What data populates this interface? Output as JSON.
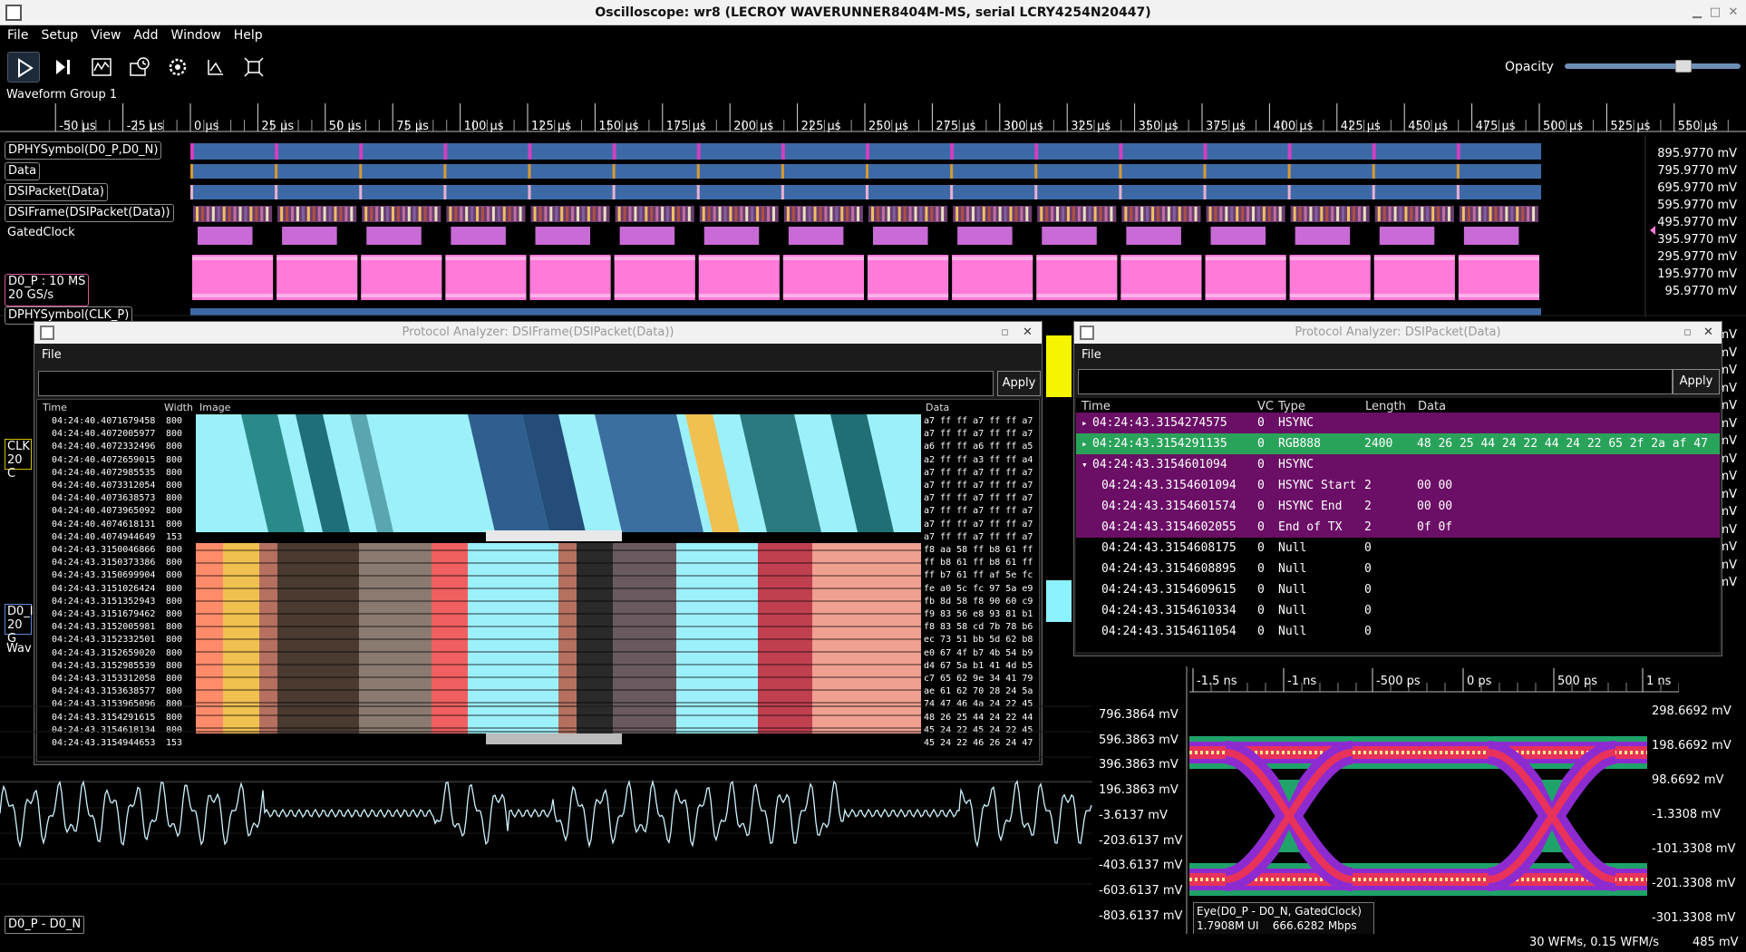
{
  "window": {
    "title": "Oscilloscope: wr8 (LECROY WAVERUNNER8404M-MS, serial LCRY4254N20447)"
  },
  "menu": [
    "File",
    "Setup",
    "View",
    "Add",
    "Window",
    "Help"
  ],
  "toolbar": {
    "opacity_label": "Opacity",
    "opacity_value": 0.7
  },
  "group_label": "Waveform Group 1",
  "time_axis": [
    "-50 µs",
    "-25 µs",
    "0 µs",
    "25 µs",
    "50 µs",
    "75 µs",
    "100 µs",
    "125 µs",
    "150 µs",
    "175 µs",
    "200 µs",
    "225 µs",
    "250 µs",
    "275 µs",
    "300 µs",
    "325 µs",
    "350 µs",
    "375 µs",
    "400 µs",
    "425 µs",
    "450 µs",
    "475 µs",
    "500 µs",
    "525 µs",
    "550 µs"
  ],
  "channels": [
    "DPHYSymbol(D0_P,D0_N)",
    "Data",
    "DSIPacket(Data)",
    "DSIFrame(DSIPacket(Data))",
    "GatedClock"
  ],
  "d0p_label": [
    "D0_P : 10 MS",
    "20 GS/s"
  ],
  "clk_label": "DPHYSymbol(CLK_P)",
  "partial_labels": {
    "clk": "CLK",
    "clk2": "20 C",
    "d0": "D0_I",
    "d0b": "20 G",
    "wav": "Wav"
  },
  "voltage_axis": [
    "895.9770 mV",
    "795.9770 mV",
    "695.9770 mV",
    "595.9770 mV",
    "495.9770 mV",
    "395.9770 mV",
    "295.9770 mV",
    "195.9770 mV",
    "95.9770 mV"
  ],
  "voltage_fragments": [
    "mV",
    "mV",
    "mV",
    "mV",
    "mV",
    "mV",
    "mV",
    "mV",
    "mV",
    "mV",
    "mV",
    "mV",
    "mV",
    "mV",
    "mV"
  ],
  "frame_window": {
    "title": "Protocol Analyzer: DSIFrame(DSIPacket(Data))",
    "menu": "File",
    "apply": "Apply",
    "headers": {
      "time": "Time",
      "width": "Width",
      "image": "Image",
      "data": "Data"
    },
    "rows": [
      {
        "time": "04:24:40.4071679458",
        "width": "800",
        "data": "a7 ff ff a7 ff ff a7"
      },
      {
        "time": "04:24:40.4072005977",
        "width": "800",
        "data": "a7 ff ff a7 ff ff a7"
      },
      {
        "time": "04:24:40.4072332496",
        "width": "800",
        "data": "a6 ff ff a6 ff ff a5"
      },
      {
        "time": "04:24:40.4072659015",
        "width": "800",
        "data": "a2 ff ff a3 ff ff a4"
      },
      {
        "time": "04:24:40.4072985535",
        "width": "800",
        "data": "a7 ff ff a7 ff ff a7"
      },
      {
        "time": "04:24:40.4073312054",
        "width": "800",
        "data": "a7 ff ff a7 ff ff a7"
      },
      {
        "time": "04:24:40.4073638573",
        "width": "800",
        "data": "a7 ff ff a7 ff ff a7"
      },
      {
        "time": "04:24:40.4073965092",
        "width": "800",
        "data": "a7 ff ff a7 ff ff a7"
      },
      {
        "time": "04:24:40.4074618131",
        "width": "800",
        "data": "a7 ff ff a7 ff ff a7"
      },
      {
        "time": "04:24:40.4074944649",
        "width": "153",
        "data": "a7 ff ff a7 ff ff a7"
      },
      {
        "time": "04:24:43.3150046866",
        "width": "800",
        "data": "f8 aa 58 ff b8 61 ff"
      },
      {
        "time": "04:24:43.3150373386",
        "width": "800",
        "data": "ff b8 61 ff b8 61 ff"
      },
      {
        "time": "04:24:43.3150699904",
        "width": "800",
        "data": "ff b7 61 ff af 5e fc"
      },
      {
        "time": "04:24:43.3151026424",
        "width": "800",
        "data": "fe a0 5c fc 97 5a e9"
      },
      {
        "time": "04:24:43.3151352943",
        "width": "800",
        "data": "fb 8d 58 f8 90 60 c9"
      },
      {
        "time": "04:24:43.3151679462",
        "width": "800",
        "data": "f9 83 56 e8 93 81 b1"
      },
      {
        "time": "04:24:43.3152005981",
        "width": "800",
        "data": "f8 83 58 cd 7b 78 b6"
      },
      {
        "time": "04:24:43.3152332501",
        "width": "800",
        "data": "ec 73 51 bb 5d 62 b8"
      },
      {
        "time": "04:24:43.3152659020",
        "width": "800",
        "data": "e0 67 4f b7 4b 54 b9"
      },
      {
        "time": "04:24:43.3152985539",
        "width": "800",
        "data": "d4 67 5a b1 41 4d b5"
      },
      {
        "time": "04:24:43.3153312058",
        "width": "800",
        "data": "c7 65 62 9e 34 41 79"
      },
      {
        "time": "04:24:43.3153638577",
        "width": "800",
        "data": "ae 61 62 70 28 24 5a"
      },
      {
        "time": "04:24:43.3153965096",
        "width": "800",
        "data": "74 47 46 4a 24 22 45"
      },
      {
        "time": "04:24:43.3154291615",
        "width": "800",
        "data": "48 26 25 44 24 22 44"
      },
      {
        "time": "04:24:43.3154618134",
        "width": "800",
        "data": "45 24 22 45 24 22 45"
      },
      {
        "time": "04:24:43.3154944653",
        "width": "153",
        "data": "45 24 22 46 26 24 47"
      }
    ]
  },
  "packet_window": {
    "title": "Protocol Analyzer: DSIPacket(Data)",
    "menu": "File",
    "apply": "Apply",
    "headers": {
      "time": "Time",
      "vc": "VC",
      "type": "Type",
      "length": "Length",
      "data": "Data"
    },
    "rows": [
      {
        "arrow": "▸",
        "time": "04:24:43.3154274575",
        "vc": "0",
        "type": "HSYNC",
        "length": "",
        "data": "",
        "style": "purple"
      },
      {
        "arrow": "▸",
        "time": "04:24:43.3154291135",
        "vc": "0",
        "type": "RGB888",
        "length": "2400",
        "data": "48 26 25 44 24 22 44 24 22 65 2f 2a af 47",
        "style": "green"
      },
      {
        "arrow": "▾",
        "time": "04:24:43.3154601094",
        "vc": "0",
        "type": "HSYNC",
        "length": "",
        "data": "",
        "style": "purple"
      },
      {
        "arrow": "",
        "time": "04:24:43.3154601094",
        "vc": "0",
        "type": "HSYNC Start",
        "length": "2",
        "data": "00 00",
        "style": "purple",
        "indent": true
      },
      {
        "arrow": "",
        "time": "04:24:43.3154601574",
        "vc": "0",
        "type": "HSYNC End",
        "length": "2",
        "data": "00 00",
        "style": "purple",
        "indent": true
      },
      {
        "arrow": "",
        "time": "04:24:43.3154602055",
        "vc": "0",
        "type": "End of TX",
        "length": "2",
        "data": "0f 0f",
        "style": "purple",
        "indent": true
      },
      {
        "arrow": "",
        "time": "04:24:43.3154608175",
        "vc": "0",
        "type": "Null",
        "length": "0",
        "data": "",
        "style": "dark",
        "indent": true
      },
      {
        "arrow": "",
        "time": "04:24:43.3154608895",
        "vc": "0",
        "type": "Null",
        "length": "0",
        "data": "",
        "style": "dark",
        "indent": true
      },
      {
        "arrow": "",
        "time": "04:24:43.3154609615",
        "vc": "0",
        "type": "Null",
        "length": "0",
        "data": "",
        "style": "dark",
        "indent": true
      },
      {
        "arrow": "",
        "time": "04:24:43.3154610334",
        "vc": "0",
        "type": "Null",
        "length": "0",
        "data": "",
        "style": "dark",
        "indent": true
      },
      {
        "arrow": "",
        "time": "04:24:43.3154611054",
        "vc": "0",
        "type": "Null",
        "length": "0",
        "data": "",
        "style": "dark",
        "indent": true
      }
    ]
  },
  "bottom": {
    "voltage_axis": [
      "796.3864 mV",
      "596.3863 mV",
      "396.3863 mV",
      "196.3863 mV",
      "-3.6137 mV",
      "-203.6137 mV",
      "-403.6137 mV",
      "-603.6137 mV",
      "-803.6137 mV"
    ],
    "channel_label": "D0_P - D0_N"
  },
  "eye": {
    "time_axis": [
      "-1.5 ns",
      "-1 ns",
      "-500 ps",
      "0 ps",
      "500 ps",
      "1 ns"
    ],
    "voltage_axis": [
      "298.6692 mV",
      "198.6692 mV",
      "98.6692 mV",
      "-1.3308 mV",
      "-101.3308 mV",
      "-201.3308 mV",
      "-301.3308 mV"
    ],
    "label_line1": "Eye(D0_P - D0_N, GatedClock)",
    "label_ui": "1.7908M UI",
    "label_rate": "666.6282 Mbps"
  },
  "status": {
    "wfms": "30 WFMs, 0.15 WFM/s",
    "mv": "485 mV"
  },
  "colors": {
    "purple": "#6b0e66",
    "green": "#2aa35a",
    "blue": "#3d6aa6",
    "magenta": "#ff7ad9",
    "yellow": "#f5f500",
    "cyan": "#8cf2ff"
  }
}
